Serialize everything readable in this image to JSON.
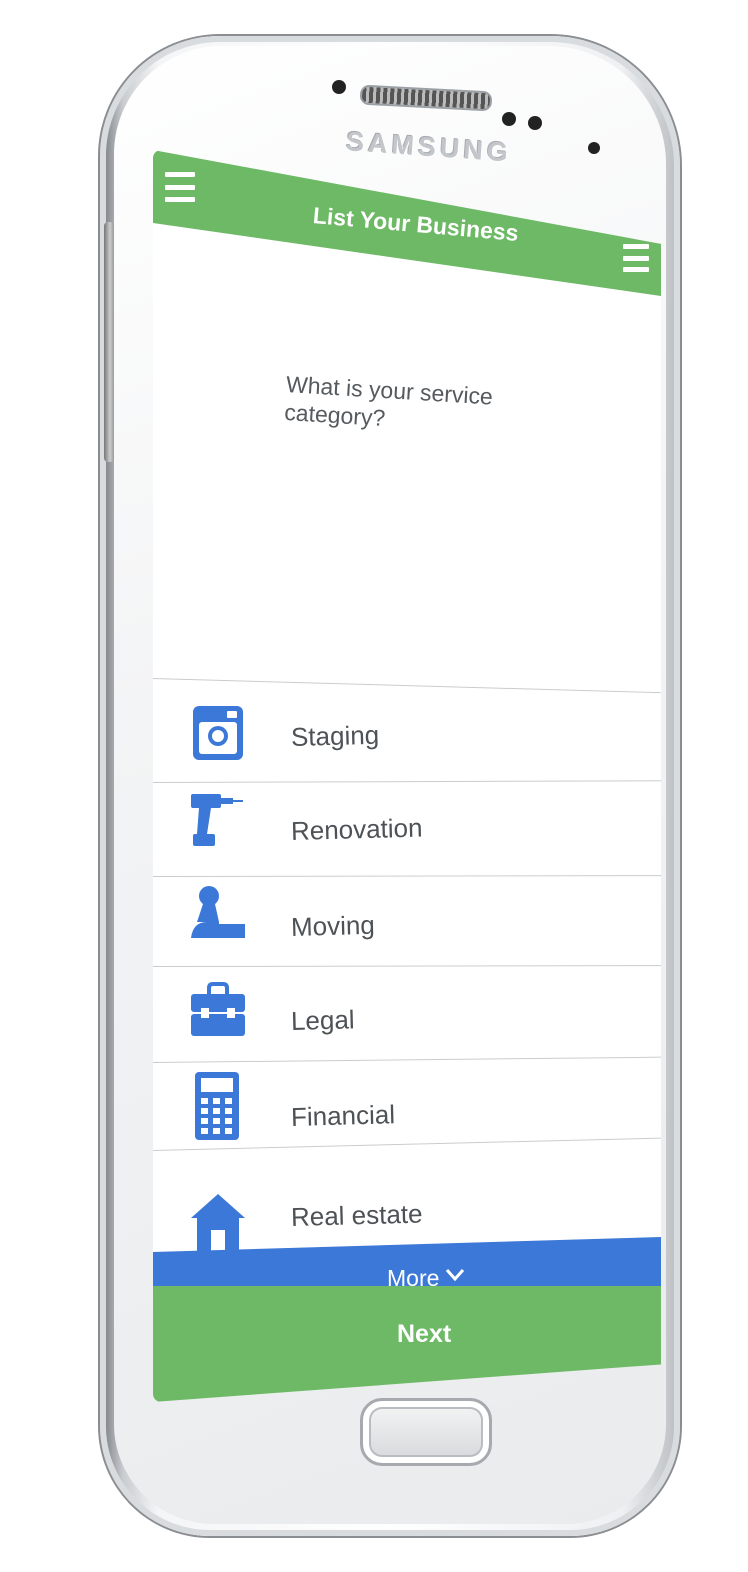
{
  "device": {
    "brand": "SAMSUNG"
  },
  "header": {
    "title": "List Your Business",
    "left_menu_icon": "hamburger-menu-icon",
    "right_menu_icon": "hamburger-menu-icon"
  },
  "question": {
    "text": "What is your service category?"
  },
  "categories": [
    {
      "label": "Staging",
      "icon": "camera-icon"
    },
    {
      "label": "Renovation",
      "icon": "drill-icon"
    },
    {
      "label": "Moving",
      "icon": "mover-icon"
    },
    {
      "label": "Legal",
      "icon": "briefcase-icon"
    },
    {
      "label": "Financial",
      "icon": "calculator-icon"
    },
    {
      "label": "Real estate",
      "icon": "house-icon"
    }
  ],
  "footer": {
    "more_label": "More",
    "more_icon": "chevron-down-icon",
    "next_label": "Next"
  },
  "colors": {
    "header_green": "#6db966",
    "icon_blue": "#3c78d8",
    "more_blue": "#3c78d8",
    "next_green": "#6db966",
    "label_gray": "#4d5256"
  }
}
